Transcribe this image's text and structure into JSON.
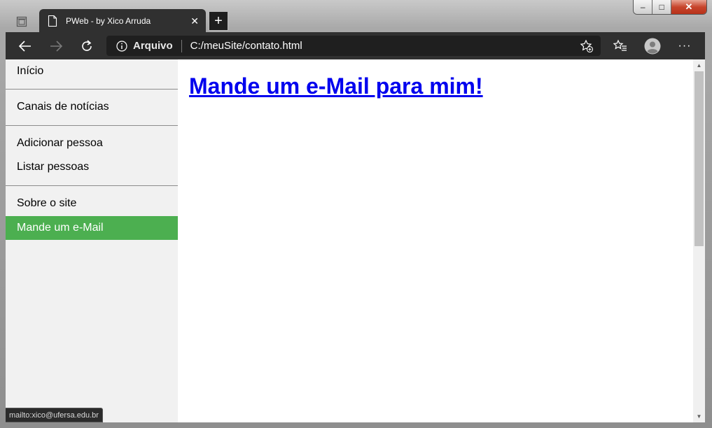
{
  "window": {
    "controls": {
      "minimize": "‒",
      "maximize": "□",
      "close": "✕"
    }
  },
  "tab": {
    "title": "PWeb - by Xico Arruda",
    "close_icon": "✕",
    "new_tab_icon": "+"
  },
  "toolbar": {
    "back_icon": "arrow-left-icon",
    "forward_icon": "arrow-right-icon",
    "refresh_icon": "refresh-icon",
    "address": {
      "scheme_label": "Arquivo",
      "url": "C:/meuSite/contato.html"
    },
    "more_icon": "···"
  },
  "sidebar": {
    "items": [
      {
        "label": "Início",
        "active": false
      },
      {
        "label": "Canais de notícias",
        "active": false
      },
      {
        "label": "Adicionar pessoa",
        "active": false
      },
      {
        "label": "Listar pessoas",
        "active": false
      },
      {
        "label": "Sobre o site",
        "active": false
      },
      {
        "label": "Mande um e-Mail",
        "active": true
      }
    ],
    "active_color": "#4caf50"
  },
  "main": {
    "heading_link": "Mande um e-Mail para mim!"
  },
  "status": {
    "link_preview": "mailto:xico@ufersa.edu.br"
  }
}
